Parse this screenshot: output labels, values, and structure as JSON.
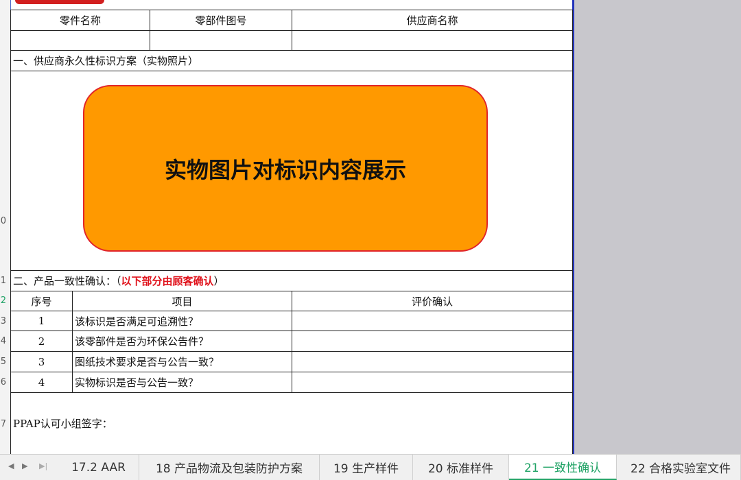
{
  "row_headers": [
    "0",
    "1",
    "2",
    "3",
    "4",
    "5",
    "6",
    "7"
  ],
  "table_header": {
    "part_name": "零件名称",
    "part_drawing_no": "零部件图号",
    "supplier_name": "供应商名称"
  },
  "section1": {
    "title": "一、供应商永久性标识方案（实物照片）",
    "shape_text": "实物图片对标识内容展示"
  },
  "section2": {
    "title_prefix": "二、产品一致性确认：（",
    "title_red": "以下部分由顾客确认",
    "title_suffix": "）",
    "col_no": "序号",
    "col_item": "项目",
    "col_eval": "评价确认",
    "rows": [
      {
        "no": "1",
        "item": "该标识是否满足可追溯性？"
      },
      {
        "no": "2",
        "item": "该零部件是否为环保公告件？"
      },
      {
        "no": "3",
        "item": "图纸技术要求是否与公告一致？"
      },
      {
        "no": "4",
        "item": "实物标识是否与公告一致？"
      }
    ]
  },
  "signature_label": "PPAP认可小组签字：",
  "tabs": [
    "17.2 AAR",
    "18 产品物流及包装防护方案",
    "19 生产样件",
    "20 标准样件",
    "21 一致性确认",
    "22 合格实验室文件"
  ],
  "active_tab": "21 一致性确认",
  "colors": {
    "shape_fill": "#ff9900",
    "shape_border": "#e1242a",
    "active_tab": "#21a366",
    "emphasis": "#e0121b"
  }
}
